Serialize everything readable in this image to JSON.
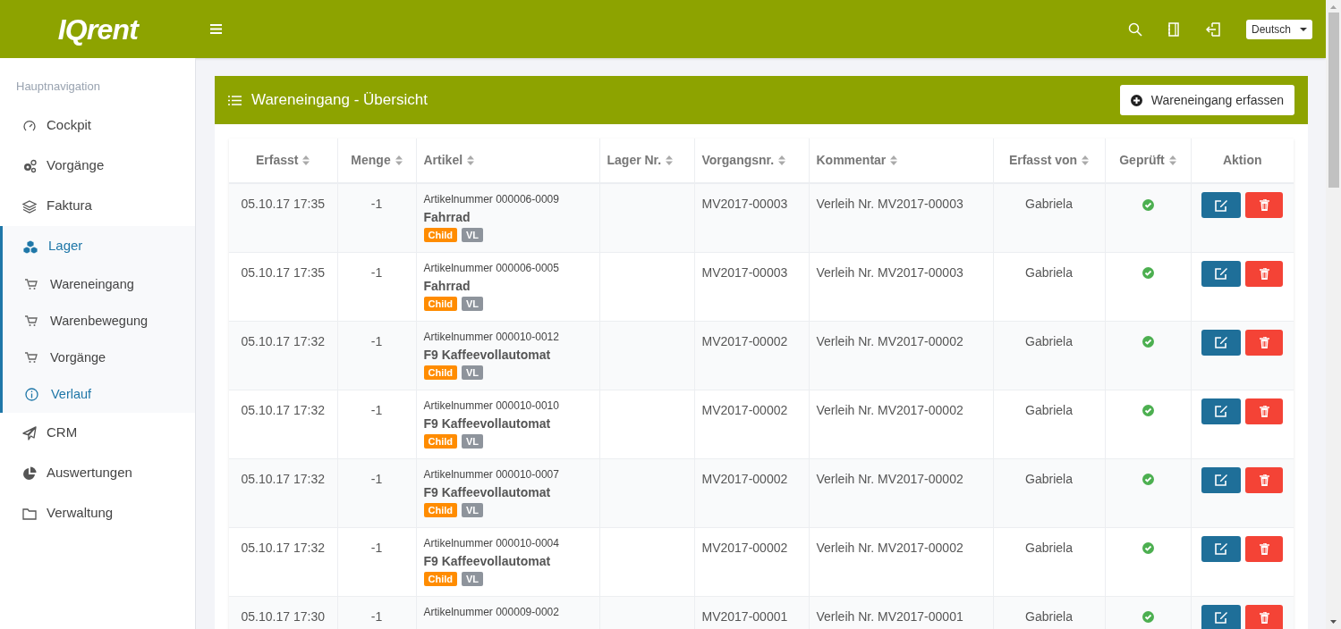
{
  "header": {
    "logo": "IQrent",
    "language": "Deutsch"
  },
  "sidebar": {
    "heading": "Hauptnavigation",
    "items": [
      {
        "label": "Cockpit",
        "selected": false
      },
      {
        "label": "Vorgänge",
        "selected": false
      },
      {
        "label": "Faktura",
        "selected": false
      },
      {
        "label": "Lager",
        "selected": true,
        "expanded": true,
        "children": [
          {
            "label": "Wareneingang",
            "selected": false
          },
          {
            "label": "Warenbewegung",
            "selected": false
          },
          {
            "label": "Vorgänge",
            "selected": false
          },
          {
            "label": "Verlauf",
            "selected": true
          }
        ]
      },
      {
        "label": "CRM",
        "selected": false
      },
      {
        "label": "Auswertungen",
        "selected": false
      },
      {
        "label": "Verwaltung",
        "selected": false
      }
    ]
  },
  "card": {
    "title": "Wareneingang - Übersicht",
    "add_button": "Wareneingang erfassen"
  },
  "table": {
    "columns": [
      {
        "label": "Erfasst",
        "sortable": true
      },
      {
        "label": "Menge",
        "sortable": true
      },
      {
        "label": "Artikel",
        "sortable": true
      },
      {
        "label": "Lager Nr.",
        "sortable": true
      },
      {
        "label": "Vorgangsnr.",
        "sortable": true
      },
      {
        "label": "Kommentar",
        "sortable": true
      },
      {
        "label": "Erfasst von",
        "sortable": true
      },
      {
        "label": "Geprüft",
        "sortable": true
      },
      {
        "label": "Aktion",
        "sortable": false
      }
    ],
    "rows": [
      {
        "erfasst": "05.10.17 17:35",
        "menge": "-1",
        "artikelnummer": "Artikelnummer 000006-0009",
        "artikel": "Fahrrad",
        "tags": [
          {
            "label": "Child",
            "color": "#ff8c00"
          },
          {
            "label": "VL",
            "color": "#8e949c"
          }
        ],
        "vorgangsnr": "MV2017-00003",
        "kommentar": "Verleih Nr. MV2017-00003",
        "erfasst_von": "Gabriela",
        "geprueft": true
      },
      {
        "erfasst": "05.10.17 17:35",
        "menge": "-1",
        "artikelnummer": "Artikelnummer 000006-0005",
        "artikel": "Fahrrad",
        "tags": [
          {
            "label": "Child",
            "color": "#ff8c00"
          },
          {
            "label": "VL",
            "color": "#8e949c"
          }
        ],
        "vorgangsnr": "MV2017-00003",
        "kommentar": "Verleih Nr. MV2017-00003",
        "erfasst_von": "Gabriela",
        "geprueft": true
      },
      {
        "erfasst": "05.10.17 17:32",
        "menge": "-1",
        "artikelnummer": "Artikelnummer 000010-0012",
        "artikel": "F9 Kaffeevollautomat",
        "tags": [
          {
            "label": "Child",
            "color": "#ff8c00"
          },
          {
            "label": "VL",
            "color": "#8e949c"
          }
        ],
        "vorgangsnr": "MV2017-00002",
        "kommentar": "Verleih Nr. MV2017-00002",
        "erfasst_von": "Gabriela",
        "geprueft": true
      },
      {
        "erfasst": "05.10.17 17:32",
        "menge": "-1",
        "artikelnummer": "Artikelnummer 000010-0010",
        "artikel": "F9 Kaffeevollautomat",
        "tags": [
          {
            "label": "Child",
            "color": "#ff8c00"
          },
          {
            "label": "VL",
            "color": "#8e949c"
          }
        ],
        "vorgangsnr": "MV2017-00002",
        "kommentar": "Verleih Nr. MV2017-00002",
        "erfasst_von": "Gabriela",
        "geprueft": true
      },
      {
        "erfasst": "05.10.17 17:32",
        "menge": "-1",
        "artikelnummer": "Artikelnummer 000010-0007",
        "artikel": "F9 Kaffeevollautomat",
        "tags": [
          {
            "label": "Child",
            "color": "#ff8c00"
          },
          {
            "label": "VL",
            "color": "#8e949c"
          }
        ],
        "vorgangsnr": "MV2017-00002",
        "kommentar": "Verleih Nr. MV2017-00002",
        "erfasst_von": "Gabriela",
        "geprueft": true
      },
      {
        "erfasst": "05.10.17 17:32",
        "menge": "-1",
        "artikelnummer": "Artikelnummer 000010-0004",
        "artikel": "F9 Kaffeevollautomat",
        "tags": [
          {
            "label": "Child",
            "color": "#ff8c00"
          },
          {
            "label": "VL",
            "color": "#8e949c"
          }
        ],
        "vorgangsnr": "MV2017-00002",
        "kommentar": "Verleih Nr. MV2017-00002",
        "erfasst_von": "Gabriela",
        "geprueft": true
      },
      {
        "erfasst": "05.10.17 17:30",
        "menge": "-1",
        "artikelnummer": "Artikelnummer 000009-0002",
        "vorgangsnr": "MV2017-00001",
        "kommentar": "Verleih Nr. MV2017-00001",
        "erfasst_von": "Gabriela",
        "geprueft": true
      }
    ]
  }
}
